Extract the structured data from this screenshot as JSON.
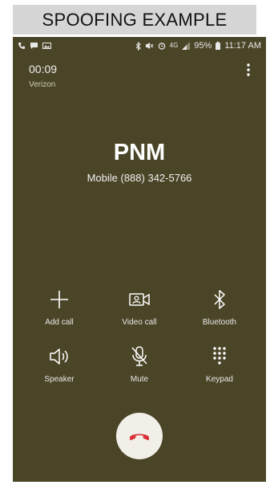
{
  "banner": {
    "title": "SPOOFING EXAMPLE"
  },
  "status_bar": {
    "left_icons": [
      "phone-icon",
      "message-icon",
      "image-icon"
    ],
    "right_icons": [
      "bluetooth-icon",
      "mute-icon",
      "alarm-icon",
      "network-icon",
      "signal-icon",
      "battery-icon"
    ],
    "network_label": "4G",
    "battery": "95%",
    "time": "11:17 AM"
  },
  "call": {
    "timer": "00:09",
    "carrier": "Verizon",
    "caller_name": "PNM",
    "caller_number": "Mobile  (888) 342-5766"
  },
  "controls": [
    {
      "label": "Add call",
      "icon": "plus-icon"
    },
    {
      "label": "Video call",
      "icon": "video-call-icon"
    },
    {
      "label": "Bluetooth",
      "icon": "bluetooth-icon"
    },
    {
      "label": "Speaker",
      "icon": "speaker-icon"
    },
    {
      "label": "Mute",
      "icon": "mic-mute-icon"
    },
    {
      "label": "Keypad",
      "icon": "keypad-icon"
    }
  ],
  "colors": {
    "background": "#4a4527",
    "end_call_button": "#f2efe8",
    "end_call_icon": "#d9323a",
    "banner": "#d6d6d6"
  }
}
